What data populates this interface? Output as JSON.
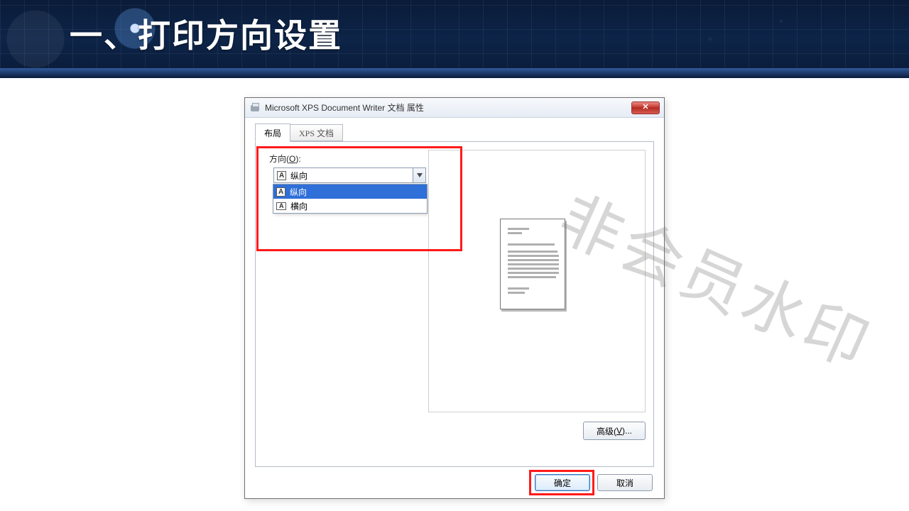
{
  "slide": {
    "title": "一、打印方向设置"
  },
  "dialog": {
    "title": "Microsoft XPS Document Writer 文档 属性",
    "close_label": "✕",
    "tabs": {
      "layout": "布局",
      "xps": "XPS 文档"
    },
    "orientation": {
      "label_prefix": "方向(",
      "label_key": "O",
      "label_suffix": "):",
      "selected": "纵向",
      "options": [
        "纵向",
        "横向"
      ]
    },
    "advanced": {
      "label_prefix": "高级(",
      "label_key": "V",
      "label_suffix": ")..."
    },
    "buttons": {
      "ok": "确定",
      "cancel": "取消"
    }
  },
  "watermark": "非会员水印"
}
